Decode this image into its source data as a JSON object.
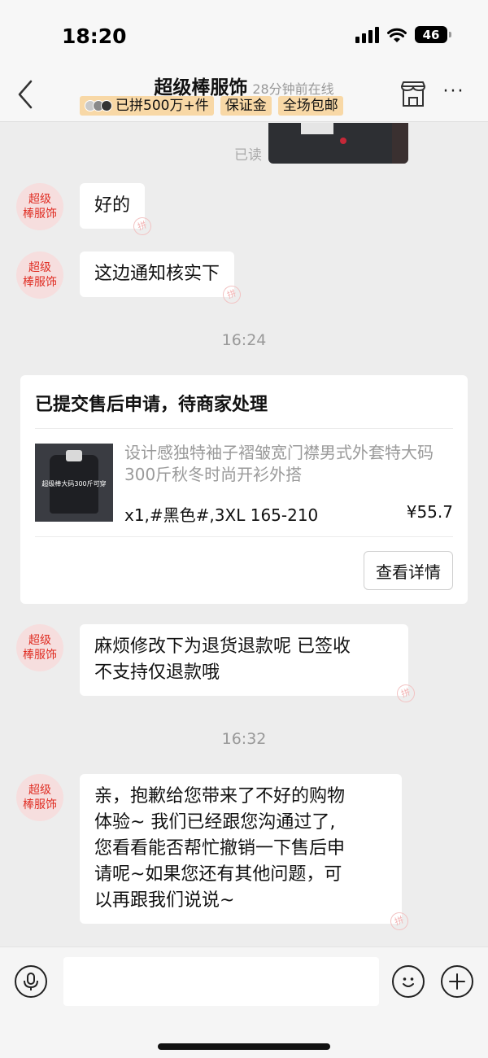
{
  "status_bar": {
    "time": "18:20",
    "battery": "46"
  },
  "header": {
    "title": "超级棒服饰",
    "online_status": "28分钟前在线",
    "badges": [
      "已拼500万+件",
      "保证金",
      "全场包邮"
    ]
  },
  "chat": {
    "read_receipt": "已读",
    "shop_avatar_text": "超级\n棒服饰",
    "watermark": "拼",
    "messages": [
      {
        "text": "好的"
      },
      {
        "text": "这边通知核实下"
      },
      {
        "text": "麻烦修改下为退货退款呢 已签收\n不支持仅退款哦"
      },
      {
        "text": "亲，抱歉给您带来了不好的购物\n体验~ 我们已经跟您沟通过了,\n您看看能否帮忙撤销一下售后申\n请呢~如果您还有其他问题，可\n以再跟我们说说~"
      }
    ],
    "timestamps": [
      "16:24",
      "16:32"
    ],
    "order_card": {
      "title": "已提交售后申请，待商家处理",
      "product_name": "设计感独特袖子褶皱宽门襟男式外套特大码300斤秋冬时尚开衫外搭",
      "thumb_text": "超级棒大码300斤可穿",
      "spec": "x1,#黑色#,3XL 165-210",
      "price": "¥55.7",
      "detail_button": "查看详情"
    }
  },
  "input_bar": {
    "placeholder": ""
  }
}
